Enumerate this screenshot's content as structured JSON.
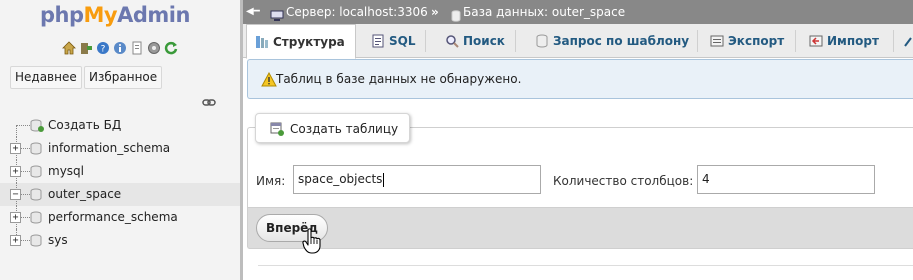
{
  "nav": {
    "logo": {
      "part1": "php",
      "part2": "My",
      "part3": "Admin"
    },
    "quick_icons": [
      "home-icon",
      "logout-icon",
      "help-icon",
      "docs-icon",
      "copy-icon",
      "settings-icon",
      "reload-icon"
    ],
    "recent_label": "Недавнее",
    "favorites_label": "Избранное",
    "tree": [
      {
        "label": "Создать БД",
        "expander": ""
      },
      {
        "label": "information_schema",
        "expander": "+"
      },
      {
        "label": "mysql",
        "expander": "+"
      },
      {
        "label": "outer_space",
        "expander": "−"
      },
      {
        "label": "performance_schema",
        "expander": "+"
      },
      {
        "label": "sys",
        "expander": "+"
      }
    ]
  },
  "breadcrumb": {
    "server": "Сервер: localhost:3306",
    "separator": "»",
    "database": "База данных: outer_space"
  },
  "tabs": [
    {
      "label": "Структура",
      "icon": "structure-icon",
      "active": true
    },
    {
      "label": "SQL",
      "icon": "sql-icon"
    },
    {
      "label": "Поиск",
      "icon": "search-icon"
    },
    {
      "label": "Запрос по шаблону",
      "icon": "query-icon"
    },
    {
      "label": "Экспорт",
      "icon": "export-icon"
    },
    {
      "label": "Импорт",
      "icon": "import-icon"
    }
  ],
  "notice": {
    "message": "Таблиц в базе данных не обнаружено."
  },
  "create_table": {
    "legend": "Создать таблицу",
    "name_label": "Имя:",
    "name_value": "space_objects",
    "columns_label": "Количество столбцов:",
    "columns_value": "4",
    "go_label": "Вперёд"
  },
  "colors": {
    "topbar": "#888888",
    "tab_text": "#235a81",
    "notice_bg": "#e9f1f8",
    "logo_blue": "#6c78af",
    "logo_orange": "#f89c0e"
  }
}
